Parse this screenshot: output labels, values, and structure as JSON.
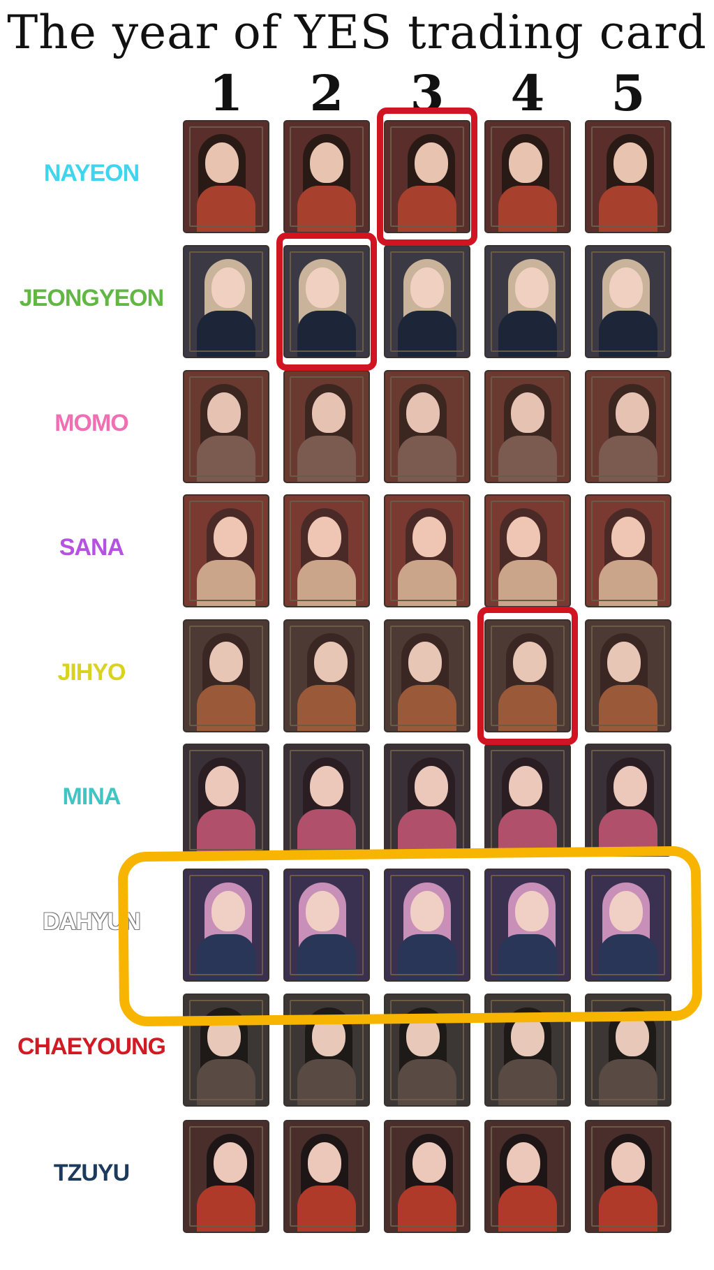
{
  "title": "The year of YES trading card",
  "columns": [
    "1",
    "2",
    "3",
    "4",
    "5"
  ],
  "members": [
    {
      "name": "NAYEON",
      "color": "#3fd5ef"
    },
    {
      "name": "JEONGYEON",
      "color": "#62b744"
    },
    {
      "name": "MOMO",
      "color": "#f06fb4"
    },
    {
      "name": "SANA",
      "color": "#b552e0"
    },
    {
      "name": "JIHYO",
      "color": "#d9d21e"
    },
    {
      "name": "MINA",
      "color": "#3ec5c4"
    },
    {
      "name": "DAHYUN",
      "color": "#ffffff"
    },
    {
      "name": "CHAEYOUNG",
      "color": "#d11a24"
    },
    {
      "name": "TZUYU",
      "color": "#1b3a5c"
    }
  ],
  "highlights": {
    "red_marked_cards": [
      {
        "member": "NAYEON",
        "card": 3
      },
      {
        "member": "JEONGYEON",
        "card": 2
      },
      {
        "member": "JIHYO",
        "card": 4
      }
    ],
    "yellow_marked_row": "DAHYUN"
  },
  "colors": {
    "red_marker": "#d11422",
    "yellow_marker": "#f7b400"
  }
}
